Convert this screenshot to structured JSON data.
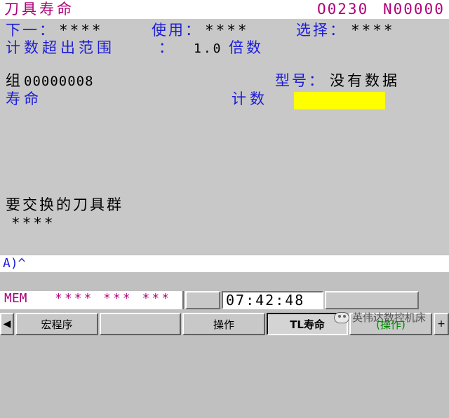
{
  "header": {
    "screen_title": "刀具寿命",
    "program_no": "O0230",
    "sequence_no": "N00000"
  },
  "main": {
    "next_label": "下一：",
    "next_value": "****",
    "use_label": "使用：",
    "use_value": "****",
    "select_label": "选择：",
    "select_value": "****",
    "over_count_label": "计数超出范围",
    "over_count_colon": "：",
    "over_count_value": "1.0",
    "over_count_unit": "倍数",
    "group_label": "组",
    "group_value": "00000008",
    "type_label": "型号：",
    "type_value": "没有数据",
    "life_label": "寿命",
    "count_label": "计数",
    "tool_group_to_change_label": "要交换的刀具群",
    "tool_group_to_change_value": "****"
  },
  "input_line": {
    "prompt": "A)^"
  },
  "status": {
    "mode": "MEM",
    "state_fields": "**** *** ***",
    "clock": "07:42:48"
  },
  "softkeys": {
    "left_arrow": "◀",
    "k1": "宏程序",
    "k2": "",
    "k3": "操作",
    "k4": "TL寿命",
    "k5": "(操作)",
    "right_arrow": "+"
  },
  "watermark": {
    "text": "英伟达数控机床"
  },
  "colors": {
    "magenta": "#b0007a",
    "blue": "#1c1cd8",
    "highlight": "#ffff00"
  }
}
